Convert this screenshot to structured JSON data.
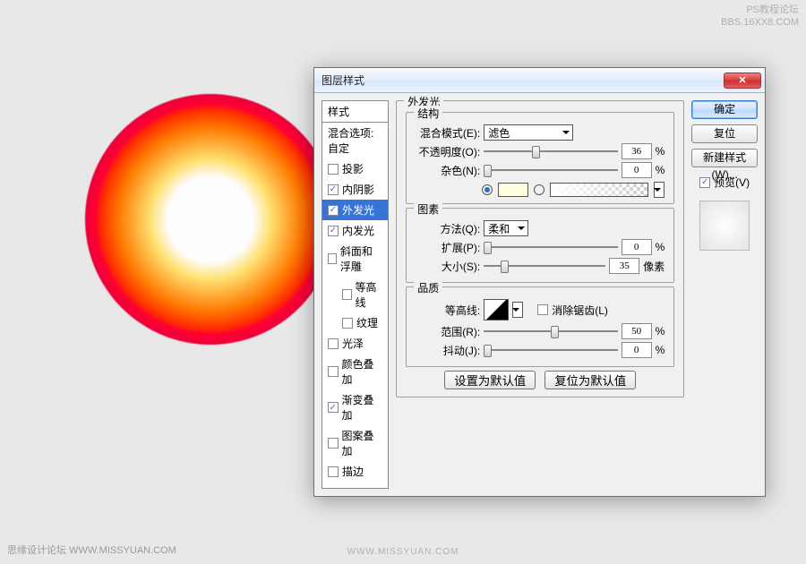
{
  "watermarks": {
    "top1": "PS教程论坛",
    "top2": "BBS.16XX8.COM",
    "bottomL": "思缘设计论坛  WWW.MISSYUAN.COM",
    "bottomC": "WWW.MISSYUAN.COM"
  },
  "dialog": {
    "title": "图层样式"
  },
  "styles": {
    "header": "样式",
    "items": [
      {
        "label": "混合选项:自定",
        "checked": null
      },
      {
        "label": "投影",
        "checked": false
      },
      {
        "label": "内阴影",
        "checked": true
      },
      {
        "label": "外发光",
        "checked": true,
        "selected": true
      },
      {
        "label": "内发光",
        "checked": true
      },
      {
        "label": "斜面和浮雕",
        "checked": false
      },
      {
        "label": "等高线",
        "checked": false,
        "indent": true
      },
      {
        "label": "纹理",
        "checked": false,
        "indent": true
      },
      {
        "label": "光泽",
        "checked": false
      },
      {
        "label": "颜色叠加",
        "checked": false
      },
      {
        "label": "渐变叠加",
        "checked": true
      },
      {
        "label": "图案叠加",
        "checked": false
      },
      {
        "label": "描边",
        "checked": false
      }
    ]
  },
  "panel": {
    "title": "外发光",
    "structure": {
      "legend": "结构",
      "blendLabel": "混合模式(E):",
      "blendValue": "滤色",
      "opacityLabel": "不透明度(O):",
      "opacityValue": "36",
      "pct": "%",
      "noiseLabel": "杂色(N):",
      "noiseValue": "0"
    },
    "elements": {
      "legend": "图素",
      "methodLabel": "方法(Q):",
      "methodValue": "柔和",
      "spreadLabel": "扩展(P):",
      "spreadValue": "0",
      "pct": "%",
      "sizeLabel": "大小(S):",
      "sizeValue": "35",
      "px": "像素"
    },
    "quality": {
      "legend": "品质",
      "contourLabel": "等高线:",
      "antialiasLabel": "消除锯齿(L)",
      "rangeLabel": "范围(R):",
      "rangeValue": "50",
      "pct": "%",
      "jitterLabel": "抖动(J):",
      "jitterValue": "0"
    },
    "buttons": {
      "setDefault": "设置为默认值",
      "resetDefault": "复位为默认值"
    }
  },
  "right": {
    "ok": "确定",
    "reset": "复位",
    "newStyle": "新建样式(W)...",
    "previewLabel": "预览(V)"
  }
}
